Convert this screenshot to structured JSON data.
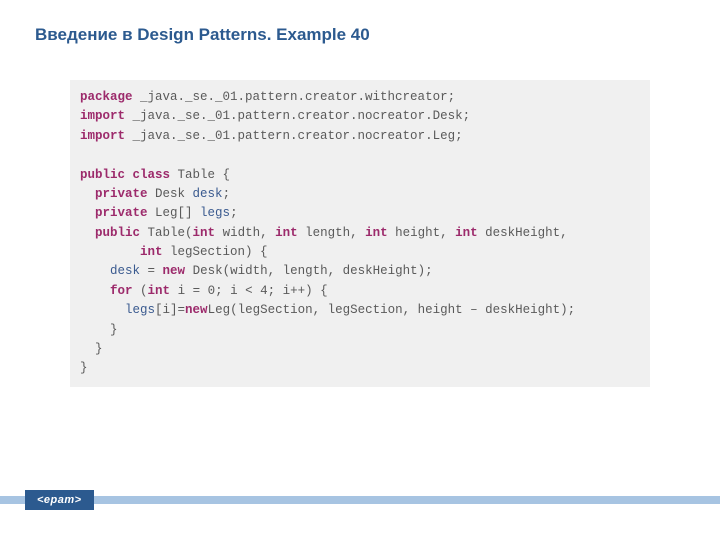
{
  "title": "Введение в Design Patterns. Example 40",
  "footer": {
    "logo": "<epam>"
  },
  "code": {
    "tokens": [
      [
        {
          "t": "kw",
          "v": "package"
        },
        {
          "t": "plain",
          "v": " _java._se._01.pattern.creator.withcreator;"
        }
      ],
      [
        {
          "t": "kw",
          "v": "import"
        },
        {
          "t": "plain",
          "v": " _java._se._01.pattern.creator.nocreator.Desk;"
        }
      ],
      [
        {
          "t": "kw",
          "v": "import"
        },
        {
          "t": "plain",
          "v": " _java._se._01.pattern.creator.nocreator.Leg;"
        }
      ],
      [
        {
          "t": "plain",
          "v": ""
        }
      ],
      [
        {
          "t": "kw",
          "v": "public class"
        },
        {
          "t": "plain",
          "v": " Table {"
        }
      ],
      [
        {
          "t": "plain",
          "v": "  "
        },
        {
          "t": "kw",
          "v": "private"
        },
        {
          "t": "plain",
          "v": " Desk "
        },
        {
          "t": "typ",
          "v": "desk"
        },
        {
          "t": "plain",
          "v": ";"
        }
      ],
      [
        {
          "t": "plain",
          "v": "  "
        },
        {
          "t": "kw",
          "v": "private"
        },
        {
          "t": "plain",
          "v": " Leg[] "
        },
        {
          "t": "typ",
          "v": "legs"
        },
        {
          "t": "plain",
          "v": ";"
        }
      ],
      [
        {
          "t": "plain",
          "v": "  "
        },
        {
          "t": "kw",
          "v": "public"
        },
        {
          "t": "plain",
          "v": " Table("
        },
        {
          "t": "kw",
          "v": "int"
        },
        {
          "t": "plain",
          "v": " width, "
        },
        {
          "t": "kw",
          "v": "int"
        },
        {
          "t": "plain",
          "v": " length, "
        },
        {
          "t": "kw",
          "v": "int"
        },
        {
          "t": "plain",
          "v": " height, "
        },
        {
          "t": "kw",
          "v": "int"
        },
        {
          "t": "plain",
          "v": " deskHeight,"
        }
      ],
      [
        {
          "t": "plain",
          "v": "        "
        },
        {
          "t": "kw",
          "v": "int"
        },
        {
          "t": "plain",
          "v": " legSection) {"
        }
      ],
      [
        {
          "t": "plain",
          "v": "    "
        },
        {
          "t": "typ",
          "v": "desk"
        },
        {
          "t": "plain",
          "v": " = "
        },
        {
          "t": "kw",
          "v": "new"
        },
        {
          "t": "plain",
          "v": " Desk(width, length, deskHeight);"
        }
      ],
      [
        {
          "t": "plain",
          "v": "    "
        },
        {
          "t": "kw",
          "v": "for"
        },
        {
          "t": "plain",
          "v": " ("
        },
        {
          "t": "kw",
          "v": "int"
        },
        {
          "t": "plain",
          "v": " i = 0; i < 4; i++) {"
        }
      ],
      [
        {
          "t": "plain",
          "v": "      "
        },
        {
          "t": "typ",
          "v": "legs"
        },
        {
          "t": "plain",
          "v": "[i]="
        },
        {
          "t": "kw",
          "v": "new"
        },
        {
          "t": "plain",
          "v": "Leg(legSection, legSection, height – deskHeight);"
        }
      ],
      [
        {
          "t": "plain",
          "v": "    }"
        }
      ],
      [
        {
          "t": "plain",
          "v": "  }"
        }
      ],
      [
        {
          "t": "plain",
          "v": "}"
        }
      ]
    ]
  }
}
